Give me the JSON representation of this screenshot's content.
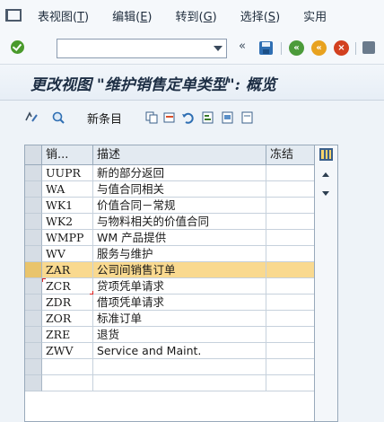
{
  "menubar": {
    "items": [
      "表视图(T)",
      "编辑(E)",
      "转到(G)",
      "选择(S)",
      "实用"
    ]
  },
  "toolbar": {
    "command_value": "",
    "double_arrow": "«"
  },
  "title": "更改视图 \"维护销售定单类型\": 概览",
  "app_toolbar": {
    "new_entries_label": "新条目"
  },
  "table": {
    "headers": [
      "销...",
      "描述",
      "冻结"
    ],
    "rows": [
      {
        "code": "UUPR",
        "desc": "新的部分返回",
        "frozen": ""
      },
      {
        "code": "WA",
        "desc": "与值合同相关",
        "frozen": ""
      },
      {
        "code": "WK1",
        "desc": "价值合同－常规",
        "frozen": ""
      },
      {
        "code": "WK2",
        "desc": "与物料相关的价值合同",
        "frozen": ""
      },
      {
        "code": "WMPP",
        "desc": "WM 产品提供",
        "frozen": ""
      },
      {
        "code": "WV",
        "desc": "服务与维护",
        "frozen": ""
      },
      {
        "code": "ZAR",
        "desc": "公司间销售订单",
        "frozen": ""
      },
      {
        "code": "ZCR",
        "desc": "贷项凭单请求",
        "frozen": ""
      },
      {
        "code": "ZDR",
        "desc": "借项凭单请求",
        "frozen": ""
      },
      {
        "code": "ZOR",
        "desc": "标准订单",
        "frozen": ""
      },
      {
        "code": "ZRE",
        "desc": "退货",
        "frozen": ""
      },
      {
        "code": "ZWV",
        "desc": "Service and Maint.",
        "frozen": ""
      },
      {
        "code": "",
        "desc": "",
        "frozen": ""
      },
      {
        "code": "",
        "desc": "",
        "frozen": ""
      }
    ],
    "selected_row": 6
  },
  "colors": {
    "selected_row": "#f9d98f",
    "header_bg": "#e3eaf1",
    "title_text": "#1d2e44"
  }
}
